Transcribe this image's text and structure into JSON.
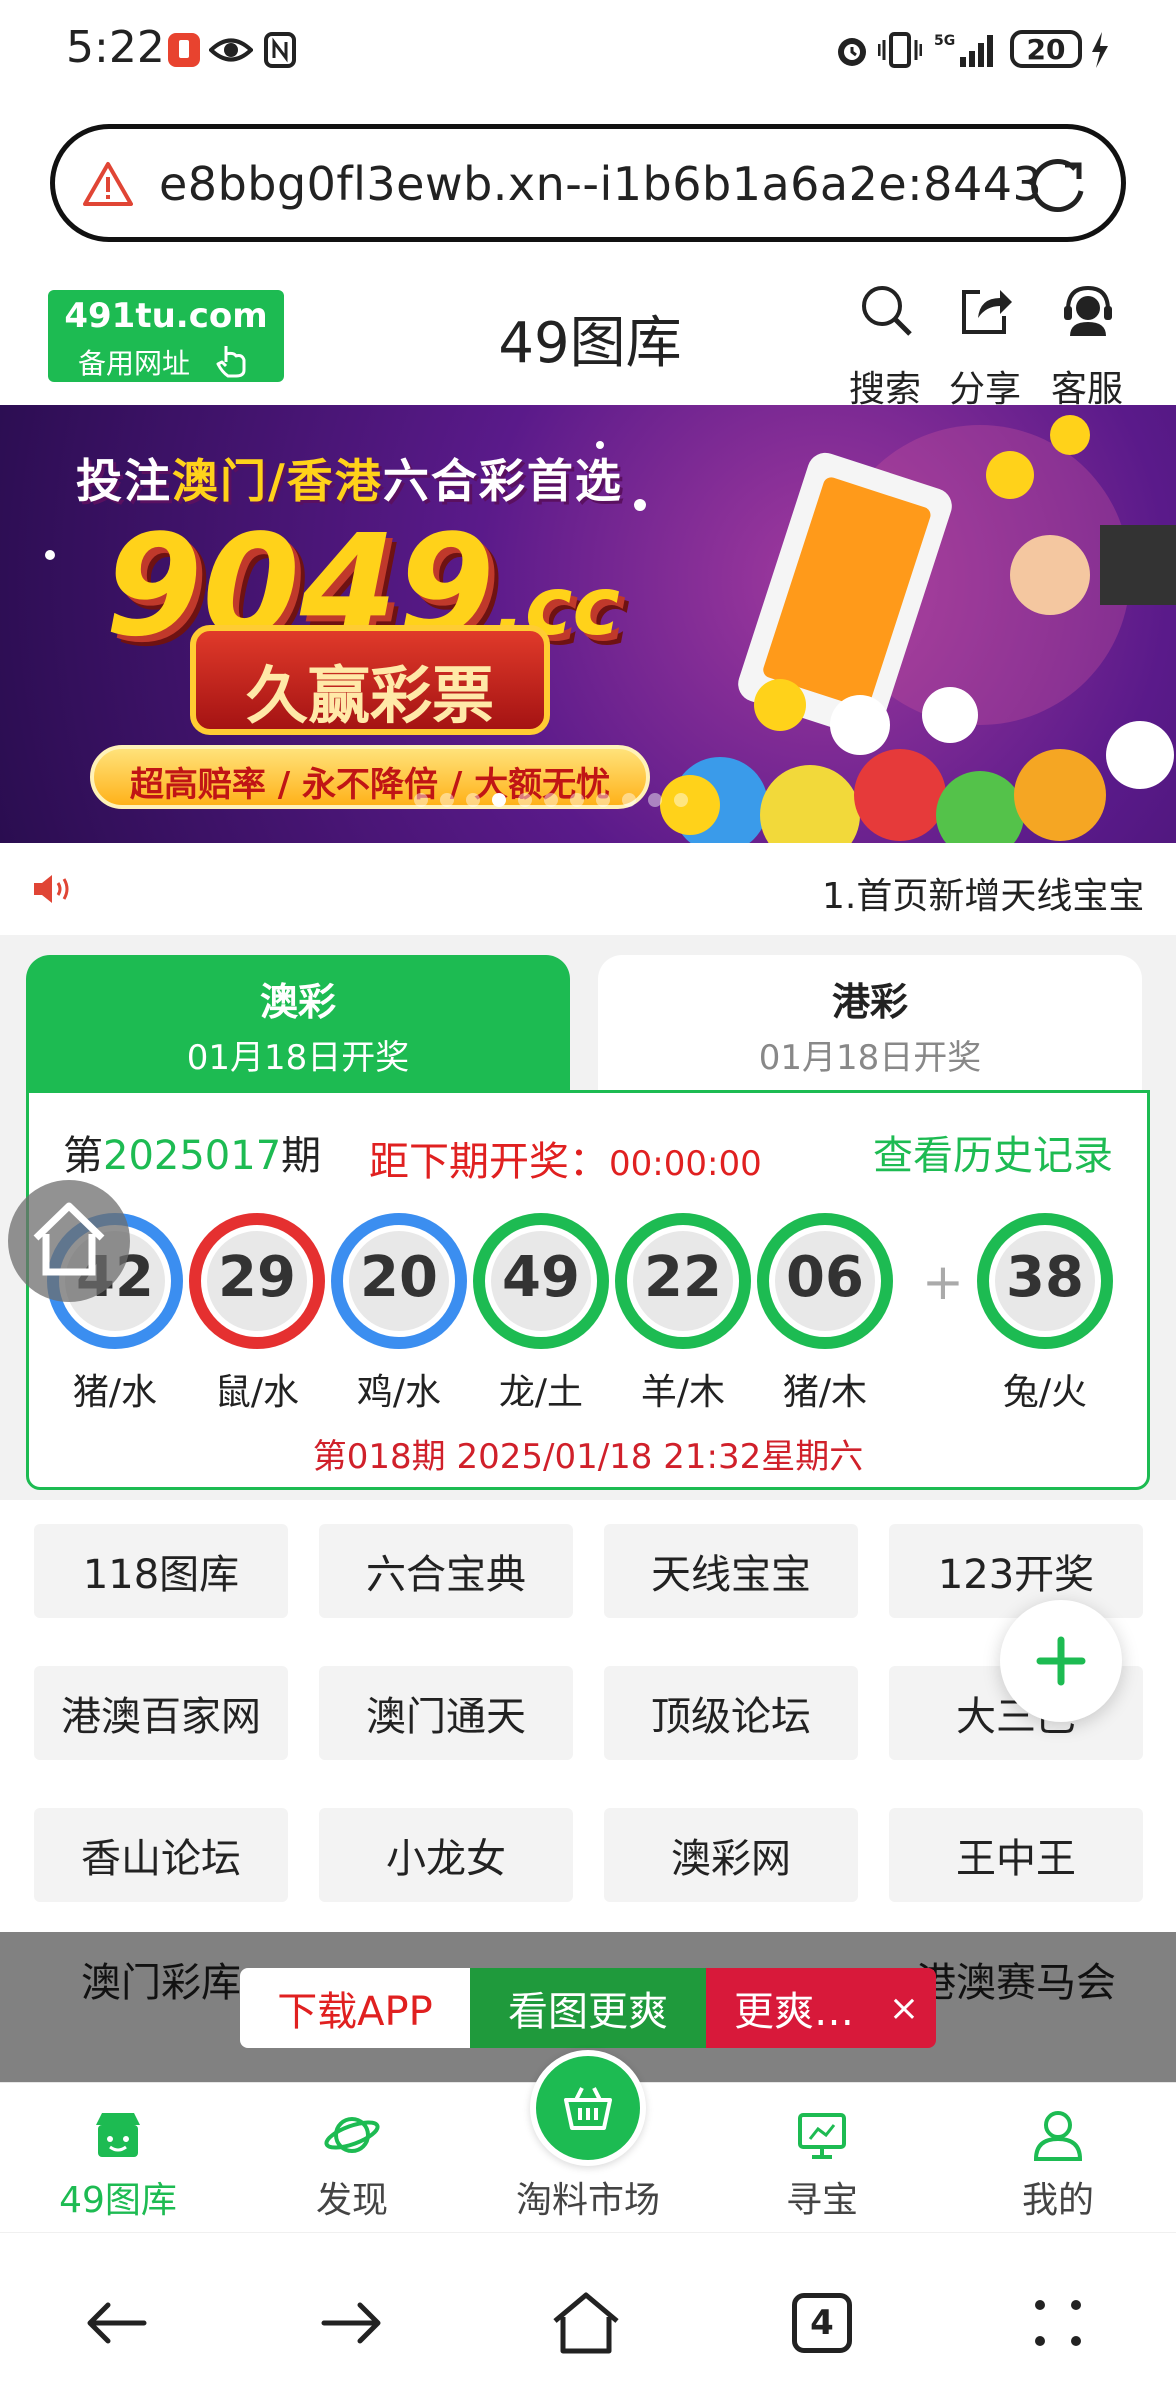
{
  "status_bar": {
    "time": "5:22",
    "battery": "20",
    "network": "5G"
  },
  "browser": {
    "url": "e8bbg0fl3ewb.xn--i1b6b1a6a2e:8443",
    "tab_count": "4"
  },
  "header": {
    "backup_domain": "491tu.com",
    "backup_label": "备用网址",
    "title": "49图库",
    "actions": [
      {
        "label": "搜索",
        "icon": "search-icon"
      },
      {
        "label": "分享",
        "icon": "share-icon"
      },
      {
        "label": "客服",
        "icon": "headset-icon"
      }
    ]
  },
  "banner": {
    "headline_prefix": "投注",
    "headline_highlight": "澳门/香港",
    "headline_suffix": "六合彩首选",
    "brand": "9049",
    "brand_suffix": ".cc",
    "name": "久赢彩票",
    "slogan": "超高赔率 / 永不降倍 / 大额无忧",
    "slides": 8,
    "active_slide": 1
  },
  "notice": {
    "text": "1.首页新增天线宝宝"
  },
  "lottery": {
    "tabs": [
      {
        "name": "澳彩",
        "date": "01月18日开奖",
        "active": true
      },
      {
        "name": "港彩",
        "date": "01月18日开奖",
        "active": false
      }
    ],
    "period_prefix": "第",
    "period_number": "2025017",
    "period_suffix": "期",
    "countdown_label": "距下期开奖：",
    "countdown_time": "00:00:00",
    "history_link": "查看历史记录",
    "balls": [
      {
        "number": "42",
        "zodiac": "猪/水",
        "color": "blue"
      },
      {
        "number": "29",
        "zodiac": "鼠/水",
        "color": "red"
      },
      {
        "number": "20",
        "zodiac": "鸡/水",
        "color": "blue"
      },
      {
        "number": "49",
        "zodiac": "龙/土",
        "color": "green"
      },
      {
        "number": "22",
        "zodiac": "羊/木",
        "color": "green"
      },
      {
        "number": "06",
        "zodiac": "猪/木",
        "color": "green"
      }
    ],
    "special_ball": {
      "number": "38",
      "zodiac": "兔/火",
      "color": "green"
    },
    "plus": "+",
    "next_draw": "第018期 2025/01/18 21:32星期六"
  },
  "link_grid": [
    [
      "118图库",
      "六合宝典",
      "天线宝宝",
      "123开奖"
    ],
    [
      "港澳百家网",
      "澳门通天",
      "顶级论坛",
      "大三巴"
    ],
    [
      "香山论坛",
      "小龙女",
      "澳彩网",
      "王中王"
    ],
    [
      "澳门彩库",
      "",
      "",
      "港澳赛马会"
    ]
  ],
  "promo": {
    "download": "下载APP",
    "view": "看图更爽",
    "more": "更爽…",
    "close": "×"
  },
  "bottom_nav": [
    {
      "label": "49图库",
      "icon": "store-icon",
      "active": true
    },
    {
      "label": "发现",
      "icon": "planet-icon",
      "active": false
    },
    {
      "label": "淘料市场",
      "icon": "basket-icon",
      "active": false
    },
    {
      "label": "寻宝",
      "icon": "monitor-icon",
      "active": false
    },
    {
      "label": "我的",
      "icon": "user-icon",
      "active": false
    }
  ],
  "colors": {
    "brand_green": "#1dbb52",
    "red": "#e53030",
    "blue": "#3b8ef0"
  }
}
